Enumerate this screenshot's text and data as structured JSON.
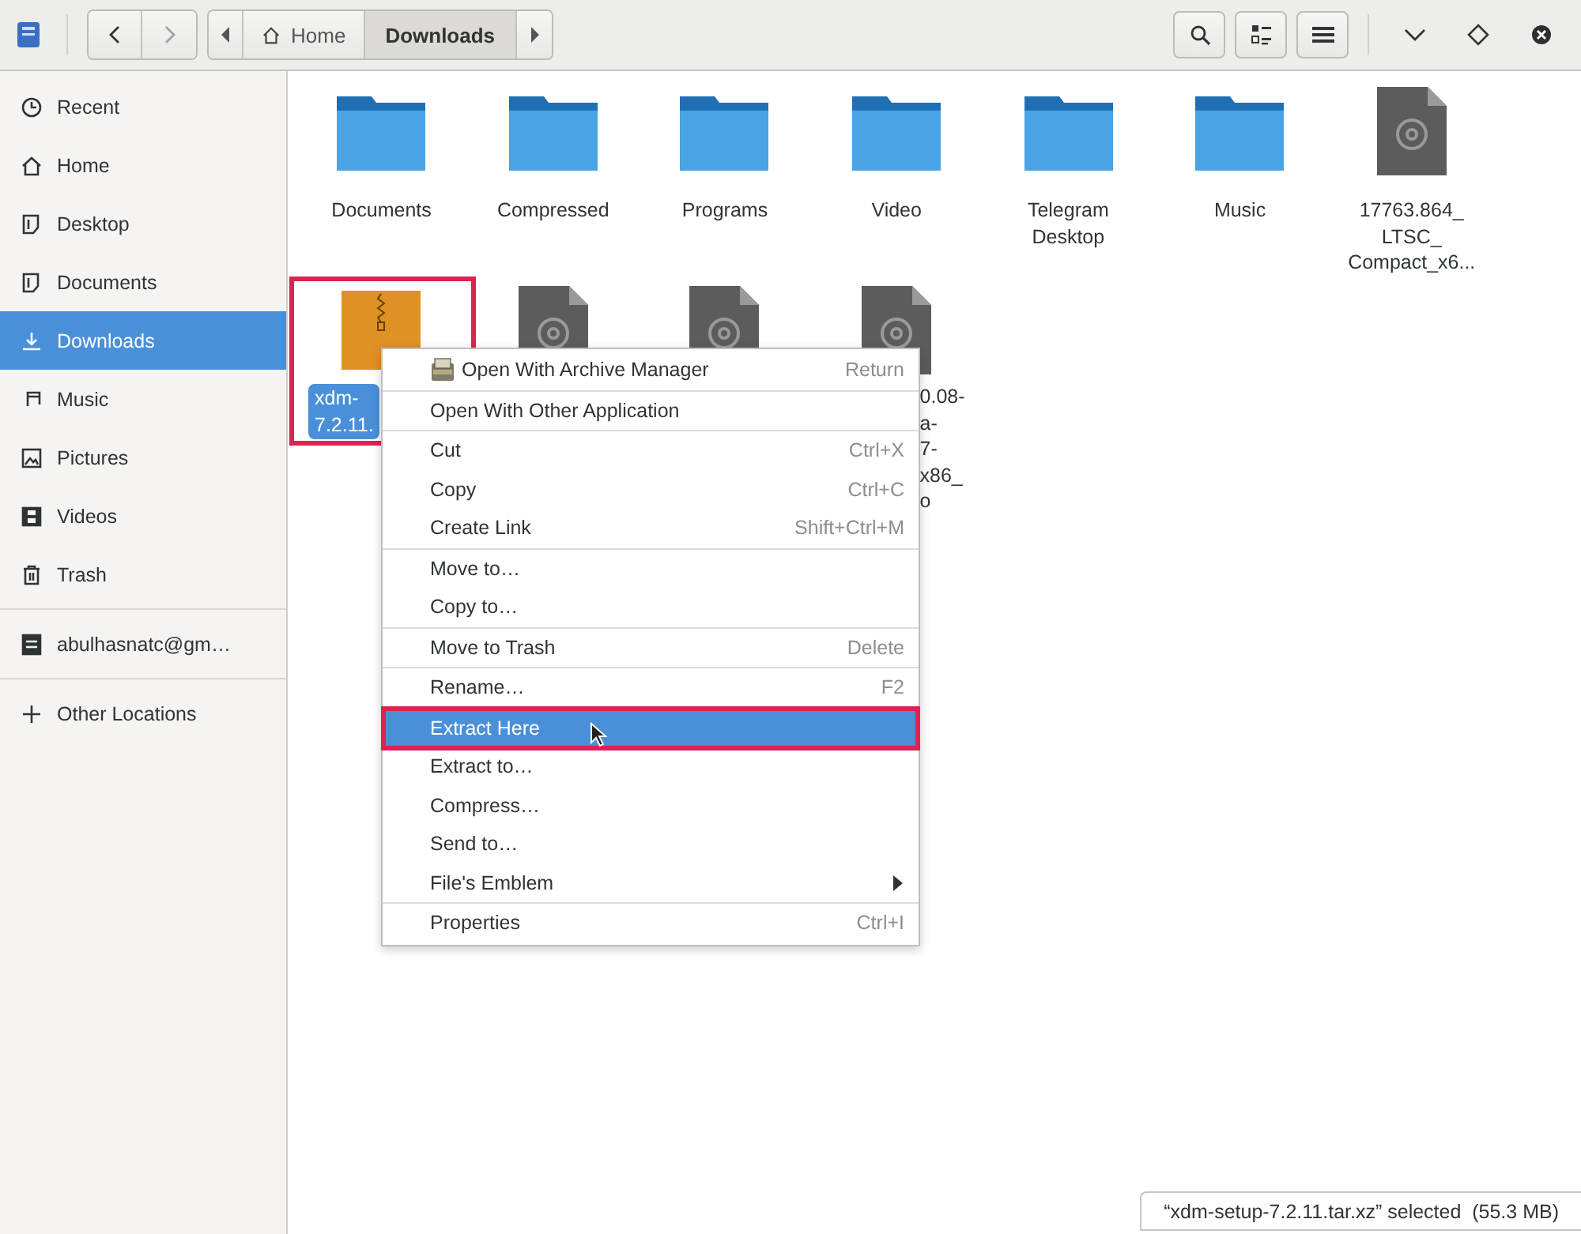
{
  "header": {
    "nav": [
      {
        "kind": "back",
        "disabled": false
      },
      {
        "kind": "forward",
        "disabled": true
      }
    ],
    "path": [
      {
        "label": "Home",
        "kind": "home",
        "selected": false
      },
      {
        "label": "Downloads",
        "kind": "folder",
        "selected": true
      }
    ],
    "tools": [
      {
        "kind": "search"
      },
      {
        "kind": "view"
      },
      {
        "kind": "menu"
      }
    ],
    "window_controls": [
      {
        "kind": "minimize"
      },
      {
        "kind": "maximize"
      },
      {
        "kind": "close"
      }
    ]
  },
  "sidebar": {
    "groups": [
      [
        {
          "label": "Recent",
          "kind": "recent",
          "selected": false
        },
        {
          "label": "Home",
          "kind": "home",
          "selected": false
        },
        {
          "label": "Desktop",
          "kind": "doc",
          "selected": false
        },
        {
          "label": "Documents",
          "kind": "doc",
          "selected": false
        },
        {
          "label": "Downloads",
          "kind": "download",
          "selected": true
        },
        {
          "label": "Music",
          "kind": "music",
          "selected": false
        },
        {
          "label": "Pictures",
          "kind": "picture",
          "selected": false
        },
        {
          "label": "Videos",
          "kind": "video",
          "selected": false
        },
        {
          "label": "Trash",
          "kind": "trash",
          "selected": false
        }
      ],
      [
        {
          "label": "abulhasnatc@gm…",
          "kind": "drive",
          "selected": false
        }
      ],
      [
        {
          "label": "Other Locations",
          "kind": "plus",
          "selected": false
        }
      ]
    ]
  },
  "files": [
    {
      "label": "Documents",
      "kind": "folder",
      "selected": false
    },
    {
      "label": "Compressed",
      "kind": "folder",
      "selected": false
    },
    {
      "label": "Programs",
      "kind": "folder",
      "selected": false
    },
    {
      "label": "Video",
      "kind": "folder",
      "selected": false
    },
    {
      "label": "Telegram\nDesktop",
      "kind": "folder",
      "selected": false
    },
    {
      "label": "Music",
      "kind": "folder",
      "selected": false
    },
    {
      "label": "17763.864_\nLTSC_\nCompact_x6...",
      "kind": "disc",
      "selected": false
    },
    {
      "label": "xdm-\n7.2.11.",
      "kind": "archive",
      "selected": true,
      "highlighted": true
    },
    {
      "kind": "disc",
      "selected": false
    },
    {
      "kind": "disc",
      "selected": false
    },
    {
      "label": "0.08-\na-\n7-\nx86_\no",
      "kind": "disc",
      "selected": false
    }
  ],
  "context_menu": {
    "sections": [
      [
        {
          "label": "Open With Archive Manager",
          "shortcut": "Return",
          "kind": "app",
          "selected": false
        }
      ],
      [
        {
          "label": "Open With Other Application",
          "kind": "plain",
          "selected": false
        }
      ],
      [
        {
          "label": "Cut",
          "shortcut": "Ctrl+X",
          "kind": "plain",
          "selected": false
        },
        {
          "label": "Copy",
          "shortcut": "Ctrl+C",
          "kind": "plain",
          "selected": false
        },
        {
          "label": "Create Link",
          "shortcut": "Shift+Ctrl+M",
          "kind": "plain",
          "selected": false
        }
      ],
      [
        {
          "label": "Move to…",
          "kind": "plain",
          "selected": false
        },
        {
          "label": "Copy to…",
          "kind": "plain",
          "selected": false
        }
      ],
      [
        {
          "label": "Move to Trash",
          "shortcut": "Delete",
          "kind": "plain",
          "selected": false
        }
      ],
      [
        {
          "label": "Rename…",
          "shortcut": "F2",
          "kind": "plain",
          "selected": false
        }
      ],
      [
        {
          "label": "Extract Here",
          "kind": "plain",
          "selected": true,
          "highlighted": true
        },
        {
          "label": "Extract to…",
          "kind": "plain",
          "selected": false
        },
        {
          "label": "Compress…",
          "kind": "plain",
          "selected": false
        },
        {
          "label": "Send to…",
          "kind": "plain",
          "selected": false
        },
        {
          "label": "File's Emblem",
          "kind": "submenu",
          "selected": false
        }
      ],
      [
        {
          "label": "Properties",
          "shortcut": "Ctrl+I",
          "kind": "plain",
          "selected": false
        }
      ]
    ]
  },
  "status_bar": {
    "text": "“xdm-setup-7.2.11.tar.xz” selected  (55.3 MB)"
  }
}
